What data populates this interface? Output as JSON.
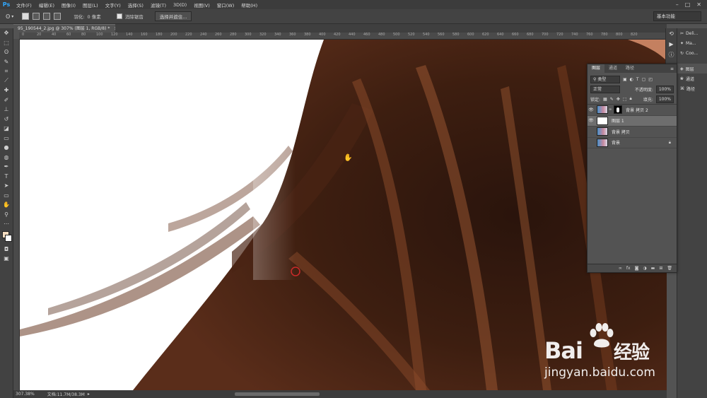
{
  "app": {
    "logo": "Ps"
  },
  "menu": [
    "文件(F)",
    "编辑(E)",
    "图像(I)",
    "图层(L)",
    "文字(Y)",
    "选择(S)",
    "滤镜(T)",
    "3D(D)",
    "视图(V)",
    "窗口(W)",
    "帮助(H)"
  ],
  "options": {
    "feather_label": "羽化:",
    "feather_value": "0 像素",
    "antialias_label": "消除锯齿",
    "refine_button": "选择并遮住...",
    "workspace": "基本功能"
  },
  "document": {
    "tab_title": "95_190544_2.jpg @ 307% (图层 1, RGB/8) *",
    "close": "×"
  },
  "ruler": {
    "h_ticks": [
      "0",
      "20",
      "40",
      "60",
      "80",
      "100",
      "120",
      "140",
      "160",
      "180",
      "200",
      "220",
      "240",
      "260",
      "280",
      "300",
      "320",
      "340",
      "360",
      "380",
      "400",
      "420",
      "440",
      "460",
      "480",
      "500",
      "520",
      "540",
      "560",
      "580",
      "600",
      "620",
      "640",
      "660",
      "680",
      "700",
      "720",
      "740",
      "760",
      "780",
      "800",
      "820"
    ]
  },
  "status": {
    "zoom": "307.38%",
    "doc_info": "文档:11.7M/38.3M"
  },
  "right_dock": {
    "top_items": [
      {
        "label": "Deli...",
        "icon": "scissors-icon"
      },
      {
        "label": "Ma...",
        "icon": "magic-icon"
      },
      {
        "label": "Coo...",
        "icon": "cycle-icon"
      }
    ],
    "panel_items": [
      {
        "label": "图层",
        "icon": "layers-icon"
      },
      {
        "label": "通道",
        "icon": "channels-icon"
      },
      {
        "label": "路径",
        "icon": "paths-icon"
      }
    ]
  },
  "layers_panel": {
    "tabs": [
      "图层",
      "通道",
      "路径"
    ],
    "filter": "类型",
    "blend_mode": "正常",
    "opacity_label": "不透明度:",
    "opacity_value": "100%",
    "lock_label": "锁定:",
    "fill_label": "填充:",
    "fill_value": "100%",
    "layers": [
      {
        "name": "背景 拷贝 2",
        "visible": true,
        "has_mask": true,
        "selected": false
      },
      {
        "name": "图层 1",
        "visible": true,
        "has_mask": false,
        "selected": true
      },
      {
        "name": "背景 拷贝",
        "visible": false,
        "has_mask": false,
        "selected": false
      },
      {
        "name": "背景",
        "visible": false,
        "has_mask": false,
        "selected": false,
        "locked": true
      }
    ]
  },
  "watermark": {
    "brand": "Bai",
    "brand2": "经验",
    "url": "jingyan.baidu.com"
  },
  "colors": {
    "hair_dark": "#2a140c",
    "hair_mid": "#5a2d1a",
    "hair_light": "#a05a34",
    "accent_red": "#cc2a2a"
  }
}
